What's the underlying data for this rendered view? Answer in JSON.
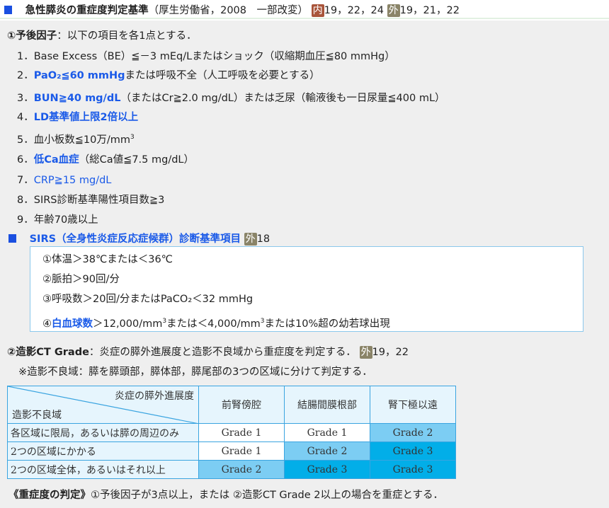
{
  "header": {
    "title": "急性膵炎の重症度判定基準",
    "source": "（厚生労働省，2008　一部改変）",
    "badge_internal": "内",
    "refs_internal": "19，22，24",
    "badge_external": "外",
    "refs_external": "19，21，22"
  },
  "prognostic": {
    "heading": "①予後因子",
    "desc": "：以下の項目を各1点とする．",
    "items": [
      {
        "n": "1．",
        "pre": "",
        "hl": "",
        "post": "Base Excess（BE）≦－3 mEq/Lまたはショック（収縮期血圧≦80 mmHg）"
      },
      {
        "n": "2．",
        "pre": "",
        "hl": "PaO₂≦60 mmHg",
        "post": "または呼吸不全（人工呼吸を必要とする）"
      },
      {
        "n": "3．",
        "pre": "",
        "hl": "BUN≧40 mg/dL",
        "post": "（またはCr≧2.0 mg/dL）または乏尿（輸液後も一日尿量≦400 mL）"
      },
      {
        "n": "4．",
        "pre": "",
        "hl": "LD基準値上限2倍以上",
        "post": ""
      },
      {
        "n": "5．",
        "pre": "",
        "hl": "",
        "post": "血小板数≦10万/mm",
        "sup": "3"
      },
      {
        "n": "6．",
        "pre": "",
        "hl": "低Ca血症",
        "post": "（総Ca値≦7.5 mg/dL）"
      },
      {
        "n": "7．",
        "pre": "",
        "hl": "",
        "post": "CRP≧15 mg/dL"
      },
      {
        "n": "8．",
        "pre": "",
        "hl": "",
        "post": "SIRS診断基準陽性項目数≧3"
      },
      {
        "n": "9．",
        "pre": "",
        "hl": "",
        "post": "年齢70歳以上"
      }
    ]
  },
  "sirs": {
    "title": "SIRS（全身性炎症反応症候群）診断基準項目",
    "badge": "外",
    "ref": "18",
    "items": [
      "①体温＞38℃または＜36℃",
      "②脈拍＞90回/分",
      "③呼吸数＞20回/分またはPaCO₂＜32 mmHg"
    ],
    "item4": {
      "n": "④",
      "hl": "白血球数",
      "a": "＞12,000/mm",
      "s1": "3",
      "b": "または＜4,000/mm",
      "s2": "3",
      "c": "または10%超の幼若球出現"
    }
  },
  "ct": {
    "heading": "②造影CT Grade",
    "desc": "：炎症の膵外進展度と造影不良域から重症度を判定する．",
    "badge": "外",
    "refs": "19，22",
    "note": "※造影不良域：膵を膵頭部，膵体部，膵尾部の3つの区域に分けて判定する．"
  },
  "table": {
    "corner_top": "炎症の膵外進展度",
    "corner_bottom": "造影不良域",
    "columns": [
      "前腎傍腔",
      "結腸間膜根部",
      "腎下極以遠"
    ],
    "rows": [
      {
        "label": "各区域に限局，あるいは膵の周辺のみ",
        "cells": [
          "Grade 1",
          "Grade 1",
          "Grade 2"
        ]
      },
      {
        "label": "2つの区域にかかる",
        "cells": [
          "Grade 1",
          "Grade 2",
          "Grade 3"
        ]
      },
      {
        "label": "2つの区域全体，あるいはそれ以上",
        "cells": [
          "Grade 2",
          "Grade 3",
          "Grade 3"
        ]
      }
    ],
    "colors": {
      "Grade 1": "#ffffff",
      "Grade 2": "#7ccdf3",
      "Grade 3": "#02aee8"
    }
  },
  "footer": {
    "label": "《重症度の判定》",
    "text": "①予後因子が3点以上，または ②造影CT Grade 2以上の場合を重症とする．"
  }
}
